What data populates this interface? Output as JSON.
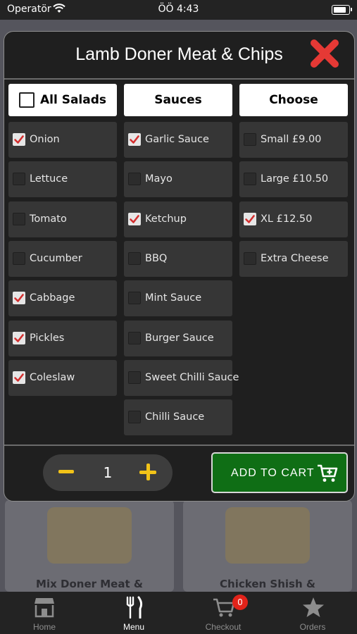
{
  "status_bar": {
    "carrier": "Operatör",
    "time": "ÖÖ 4:43"
  },
  "background": {
    "cards": [
      {
        "name": "Mix Doner Meat &"
      },
      {
        "name": "Chicken Shish &"
      }
    ]
  },
  "modal": {
    "title": "Lamb Doner Meat & Chips",
    "columns": [
      {
        "header": "All Salads",
        "header_checked": false,
        "options": [
          {
            "label": "Onion",
            "checked": true
          },
          {
            "label": "Lettuce",
            "checked": false
          },
          {
            "label": "Tomato",
            "checked": false
          },
          {
            "label": "Cucumber",
            "checked": false
          },
          {
            "label": "Cabbage",
            "checked": true
          },
          {
            "label": "Pickles",
            "checked": true
          },
          {
            "label": "Coleslaw",
            "checked": true
          }
        ]
      },
      {
        "header": "Sauces",
        "options": [
          {
            "label": "Garlic Sauce",
            "checked": true
          },
          {
            "label": "Mayo",
            "checked": false
          },
          {
            "label": "Ketchup",
            "checked": true
          },
          {
            "label": "BBQ",
            "checked": false
          },
          {
            "label": "Mint Sauce",
            "checked": false
          },
          {
            "label": "Burger Sauce",
            "checked": false
          },
          {
            "label": "Sweet Chilli Sauce",
            "checked": false
          },
          {
            "label": "Chilli Sauce",
            "checked": false
          }
        ]
      },
      {
        "header": "Choose",
        "options": [
          {
            "label": "Small £9.00",
            "checked": false
          },
          {
            "label": "Large £10.50",
            "checked": false
          },
          {
            "label": "XL £12.50",
            "checked": true
          },
          {
            "label": "Extra Cheese",
            "checked": false
          }
        ]
      }
    ],
    "quantity": "1",
    "add_to_cart_label": "ADD TO CART"
  },
  "tabbar": {
    "tabs": [
      {
        "label": "Home",
        "icon": "store-icon",
        "active": false
      },
      {
        "label": "Menu",
        "icon": "fork-knife-icon",
        "active": true
      },
      {
        "label": "Checkout",
        "icon": "cart-icon",
        "active": false
      },
      {
        "label": "Orders",
        "icon": "star-icon",
        "active": false
      }
    ],
    "cart_badge": "0"
  },
  "colors": {
    "accent_yellow": "#f2c318",
    "cart_green": "#0f6e15",
    "check_red": "#d32f2f",
    "close_red": "#e53935"
  }
}
